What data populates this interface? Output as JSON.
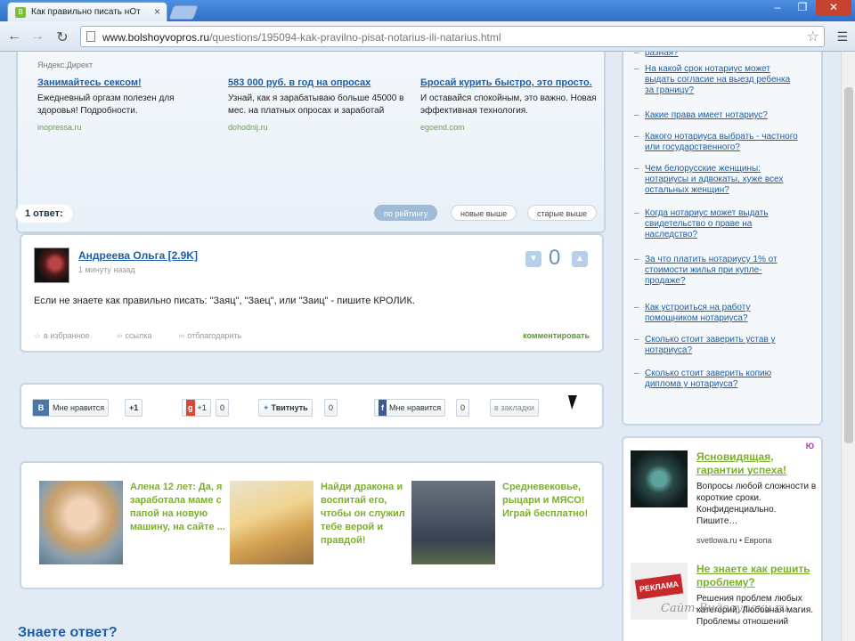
{
  "browser": {
    "tab_title": "Как правильно писать нОт",
    "tab_close": "×",
    "favicon": "В",
    "url_host": "www.bolshoyvopros.ru",
    "url_path": "/questions/195094-kak-pravilno-pisat-notarius-ili-natarius.html",
    "controls": {
      "min": "–",
      "max": "❐",
      "close": "✕"
    }
  },
  "ad_block": {
    "label": "Яндекс.Директ",
    "ads": [
      {
        "title": "Занимайтесь сексом!",
        "text": "Ежедневный оргазм полезен для здоровья! Подробности.",
        "domain": "inopressa.ru"
      },
      {
        "title": "583 000 руб. в год на опросах",
        "text": "Узнай, как я зарабатываю больше 45000 в мес. на платных опросах и заработай",
        "domain": "dohodnij.ru"
      },
      {
        "title": "Бросай курить быстро, это просто.",
        "text": "И оставайся спокойным, это важно. Новая эффективная технология.",
        "domain": "egoend.com"
      }
    ]
  },
  "answers": {
    "count_label": "1 ответ:",
    "sort": [
      "по рейтингу",
      "новые выше",
      "старые выше"
    ],
    "items": [
      {
        "author": "Андреева Ольга [2.9K]",
        "time": "1 минуту назад",
        "text": "Если не знаете как правильно писать: \"Заяц\", \"Заец\", или \"Заиц\" - пишите КРОЛИК.",
        "votes": "0",
        "actions": [
          "в избранное",
          "ссылка",
          "отблагодарить"
        ],
        "comment": "комментировать"
      }
    ]
  },
  "share": {
    "vk_label": "Мне нравится",
    "vk_icon": "B",
    "vk_count": "+1",
    "gplus_label": "+1",
    "gplus_count": "0",
    "twitter_label": "Твитнуть",
    "twitter_count": "0",
    "fb_label": "Мне нравится",
    "fb_count": "0",
    "bookmark_label": "в закладки"
  },
  "promo": [
    {
      "text": "Алена 12 лет: Да, я заработала маме с папой на новую машину, на сайте ..."
    },
    {
      "text": "Найди дракона и воспитай его, чтобы он служил тебе верой и правдой!"
    },
    {
      "text": "Средневековье, рыцари и МЯСО! Играй бесплатно!"
    }
  ],
  "know_answer": "Знаете ответ?",
  "related": [
    "разная?",
    "На какой срок нотариус может выдать согласие на выезд ребенка за границу?",
    "Какие права имеет нотариус?",
    "Какого нотариуса выбрать - частного или государственного?",
    "Чем белорусские женщины: нотариусы и адвокаты, хуже всех остальных женщин?",
    "Когда нотариус может выдать свидетельство о праве на наследство?",
    "За что платить нотариусу 1% от стоимости жилья при купле-продаже?",
    "Как устроиться на работу помощником нотариуса?",
    "Сколько стоит заверить устав у нотариуса?",
    "Сколько стоит заверить копию диплома у нотариуса?"
  ],
  "side_ads": {
    "badge": "Ю",
    "items": [
      {
        "title": "Ясновидящая, гарантии успеха!",
        "text": "Вопросы любой сложности в короткие сроки. Конфиденциально. Пишите…",
        "domain": "svetlowa.ru • Европа"
      },
      {
        "title": "Не знаете как решить проблему?",
        "text": "Решения проблем любых категорий. Любовная магия. Проблемы отношений",
        "domain": "",
        "image_label": "РЕКЛАМА"
      }
    ]
  },
  "watermark": "Сайт-Видеоуроки.ru"
}
